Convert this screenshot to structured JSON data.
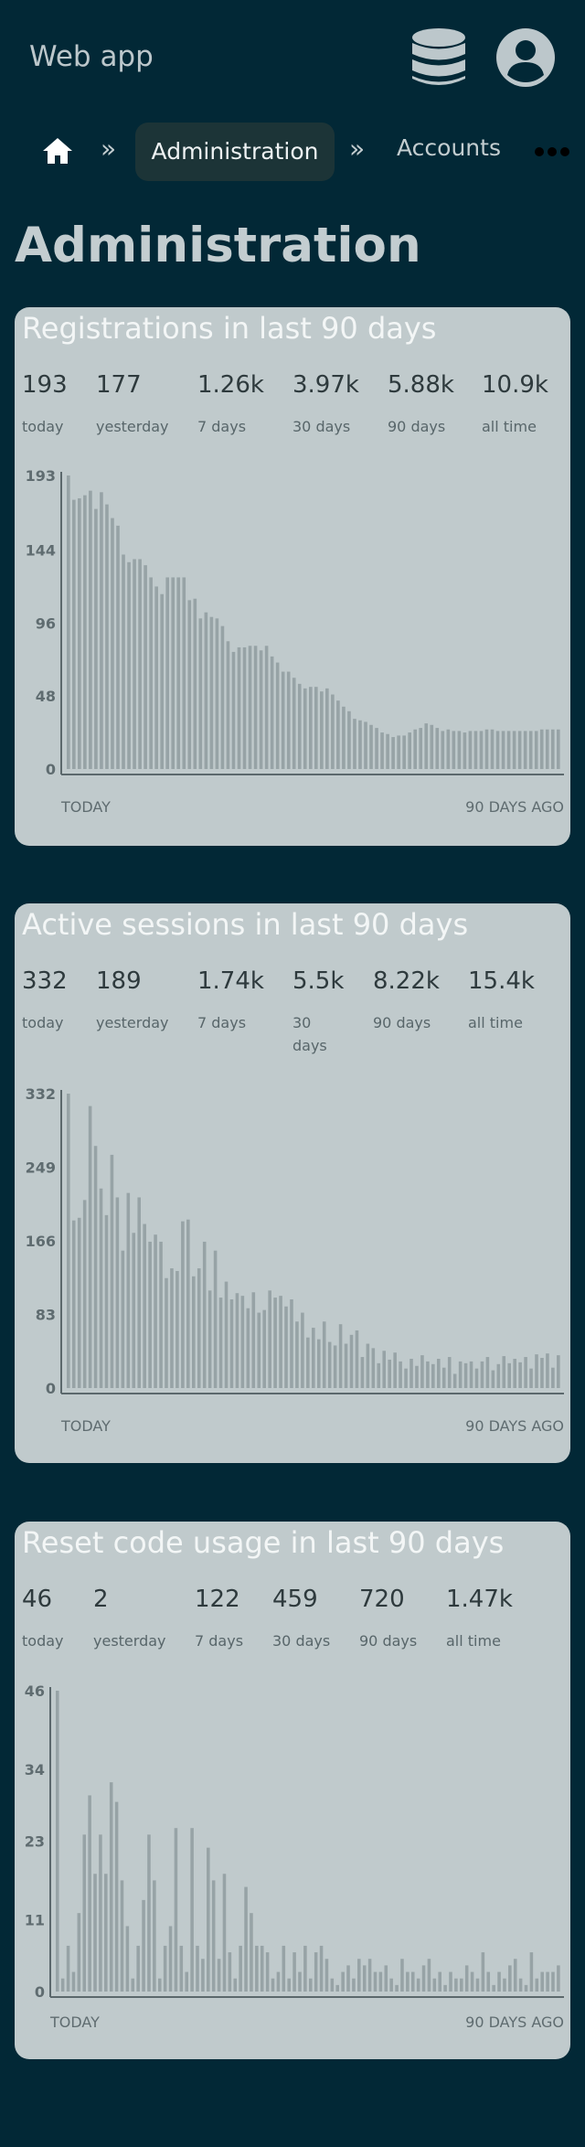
{
  "app": {
    "title": "Web app"
  },
  "icons": {
    "database": "database-icon",
    "user": "user-icon",
    "home": "home-icon",
    "more": "more-dots-icon"
  },
  "breadcrumb": {
    "separator": "»",
    "items": [
      "Administration",
      "Accounts"
    ]
  },
  "page_title": "Administration",
  "cards": [
    {
      "title": "Registrations in last 90 days",
      "stats": [
        {
          "value": "193",
          "label": "today"
        },
        {
          "value": "177",
          "label": "yesterday"
        },
        {
          "value": "1.26k",
          "label": "7 days"
        },
        {
          "value": "3.97k",
          "label": "30 days"
        },
        {
          "value": "5.88k",
          "label": "90 days"
        },
        {
          "value": "10.9k",
          "label": "all time"
        }
      ],
      "x_left": "TODAY",
      "x_right": "90 DAYS AGO"
    },
    {
      "title": "Active sessions in last 90 days",
      "stats": [
        {
          "value": "332",
          "label": "today"
        },
        {
          "value": "189",
          "label": "yesterday"
        },
        {
          "value": "1.74k",
          "label": "7 days"
        },
        {
          "value": "5.5k",
          "label": "30 days"
        },
        {
          "value": "8.22k",
          "label": "90 days"
        },
        {
          "value": "15.4k",
          "label": "all time"
        }
      ],
      "x_left": "TODAY",
      "x_right": "90 DAYS AGO"
    },
    {
      "title": "Reset code usage in last 90 days",
      "stats": [
        {
          "value": "46",
          "label": "today"
        },
        {
          "value": "2",
          "label": "yesterday"
        },
        {
          "value": "122",
          "label": "7 days"
        },
        {
          "value": "459",
          "label": "30 days"
        },
        {
          "value": "720",
          "label": "90 days"
        },
        {
          "value": "1.47k",
          "label": "all time"
        }
      ],
      "x_left": "TODAY",
      "x_right": "90 DAYS AGO"
    }
  ],
  "chart_data": [
    {
      "type": "bar",
      "ylim": [
        0,
        193
      ],
      "yticks": [
        0,
        48,
        96,
        144,
        193
      ],
      "x": [
        "TODAY",
        "90 DAYS AGO"
      ],
      "values": [
        193,
        177,
        178,
        180,
        183,
        171,
        182,
        174,
        165,
        160,
        141,
        136,
        138,
        138,
        134,
        126,
        120,
        115,
        126,
        126,
        126,
        126,
        111,
        112,
        99,
        103,
        100,
        99,
        94,
        84,
        77,
        80,
        80,
        81,
        81,
        78,
        81,
        74,
        70,
        64,
        64,
        60,
        56,
        53,
        54,
        54,
        51,
        53,
        49,
        45,
        41,
        38,
        33,
        32,
        31,
        29,
        27,
        24,
        23,
        21,
        22,
        22,
        24,
        26,
        27,
        30,
        29,
        27,
        25,
        26,
        25,
        25,
        24,
        25,
        25,
        25,
        26,
        26,
        25,
        25,
        25,
        25,
        25,
        25,
        25,
        25,
        26,
        26,
        26,
        26
      ]
    },
    {
      "type": "bar",
      "ylim": [
        0,
        332
      ],
      "yticks": [
        0,
        83,
        166,
        249,
        332
      ],
      "x": [
        "TODAY",
        "90 DAYS AGO"
      ],
      "values": [
        332,
        189,
        192,
        212,
        318,
        273,
        225,
        195,
        263,
        215,
        155,
        220,
        175,
        215,
        185,
        165,
        173,
        165,
        124,
        135,
        132,
        188,
        190,
        126,
        135,
        165,
        110,
        155,
        102,
        120,
        100,
        107,
        104,
        90,
        108,
        85,
        88,
        110,
        102,
        104,
        92,
        100,
        75,
        85,
        57,
        68,
        55,
        75,
        52,
        48,
        72,
        50,
        60,
        65,
        35,
        50,
        45,
        28,
        42,
        32,
        40,
        30,
        22,
        33,
        25,
        37,
        30,
        27,
        33,
        23,
        35,
        16,
        30,
        28,
        30,
        22,
        30,
        35,
        20,
        27,
        36,
        28,
        33,
        29,
        35,
        22,
        38,
        34,
        39,
        23,
        37
      ]
    },
    {
      "type": "bar",
      "ylim": [
        0,
        46
      ],
      "yticks": [
        0,
        11,
        23,
        34,
        46
      ],
      "x": [
        "TODAY",
        "90 DAYS AGO"
      ],
      "values": [
        46,
        2,
        7,
        3,
        12,
        24,
        30,
        18,
        24,
        18,
        32,
        29,
        17,
        10,
        2,
        7,
        14,
        24,
        17,
        2,
        7,
        10,
        25,
        7,
        3,
        25,
        7,
        5,
        22,
        17,
        5,
        18,
        6,
        2,
        7,
        16,
        12,
        7,
        7,
        6,
        2,
        3,
        7,
        2,
        6,
        3,
        7,
        2,
        6,
        7,
        5,
        2,
        1,
        3,
        4,
        2,
        5,
        4,
        5,
        3,
        3,
        4,
        2,
        1,
        5,
        3,
        3,
        2,
        4,
        5,
        2,
        3,
        1,
        3,
        2,
        2,
        4,
        3,
        2,
        6,
        3,
        1,
        3,
        2,
        4,
        5,
        2,
        1,
        6,
        2,
        3,
        3,
        3,
        4
      ]
    }
  ]
}
